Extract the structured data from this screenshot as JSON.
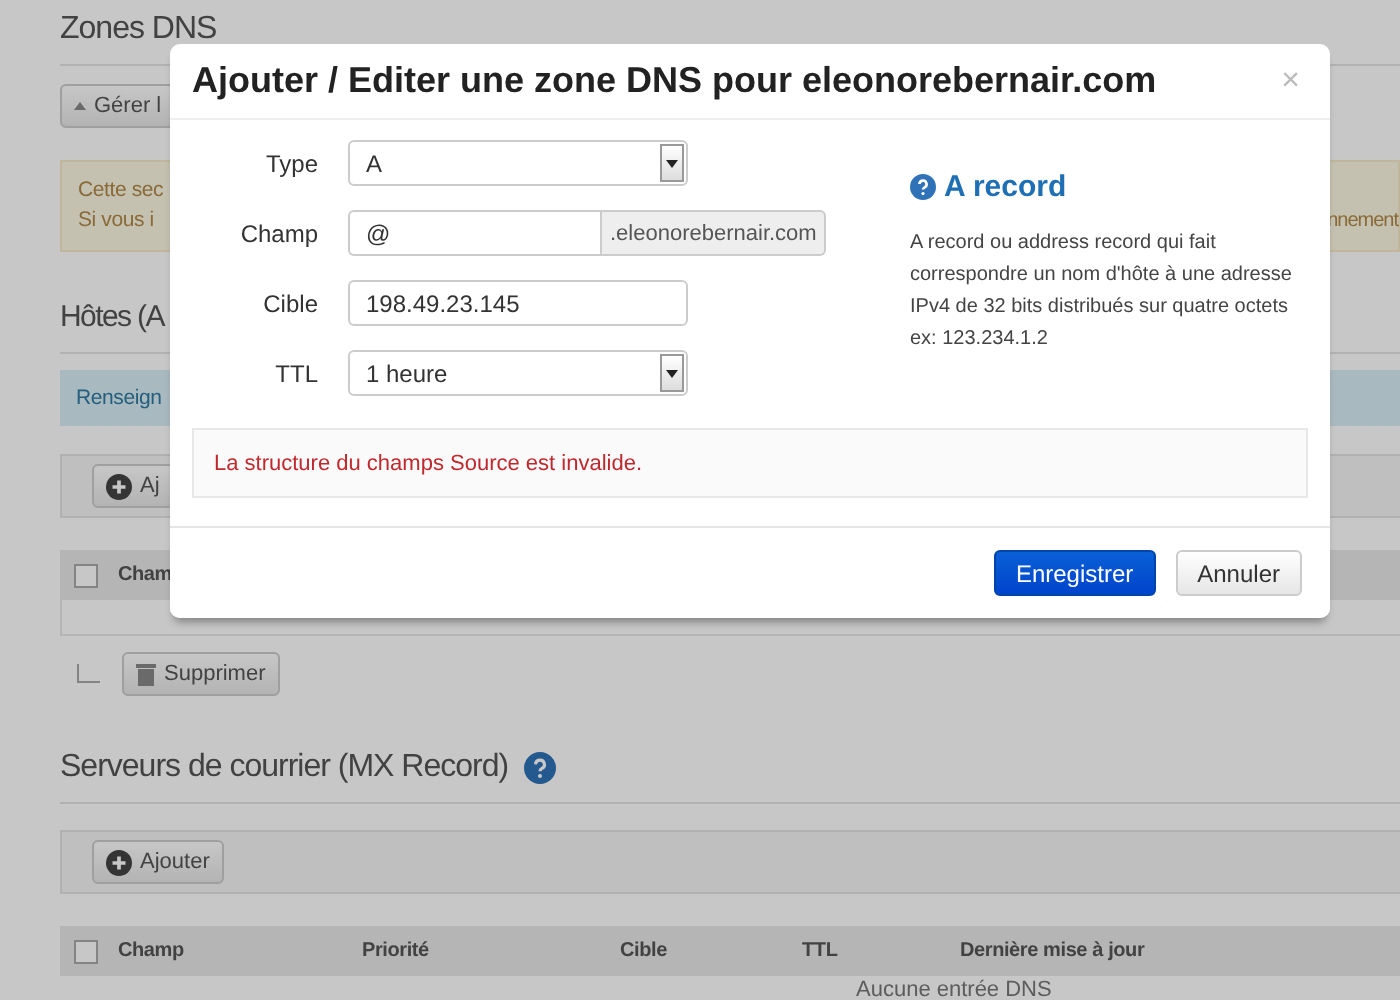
{
  "page": {
    "zones_title": "Zones DNS",
    "manage_button": "Gérer l",
    "notice_lines": [
      "Cette sec",
      "Si vous i"
    ],
    "notice_tail": "nnement",
    "hosts_title": "Hôtes (A",
    "hosts_info": "Renseign",
    "hosts_add": "Aj",
    "hosts_table": {
      "checked": false,
      "columns": [
        "Cham"
      ]
    },
    "delete_button": "Supprimer",
    "mx_title": "Serveurs de courrier (MX Record)",
    "mx_add": "Ajouter",
    "mx_table": {
      "checked": false,
      "columns": [
        "Champ",
        "Priorité",
        "Cible",
        "TTL",
        "Dernière mise à jour"
      ],
      "empty_text": "Aucune entrée DNS"
    }
  },
  "modal": {
    "title": "Ajouter / Editer une zone DNS pour eleonorebernair.com",
    "close": "×",
    "fields": [
      {
        "kind": "select",
        "label": "Type",
        "value": "A"
      },
      {
        "kind": "text",
        "label": "Champ",
        "value": "@",
        "suffix": ".eleonorebernair.com"
      },
      {
        "kind": "text",
        "label": "Cible",
        "value": "198.49.23.145"
      },
      {
        "kind": "select",
        "label": "TTL",
        "value": "1 heure"
      }
    ],
    "help": {
      "title": "A record",
      "lines": [
        "A record ou address record qui fait",
        "correspondre un nom d'hôte à une adresse",
        "IPv4 de 32 bits distribués sur quatre octets",
        "ex: 123.234.1.2"
      ]
    },
    "error": "La structure du champs Source est invalide.",
    "buttons": [
      {
        "label": "Enregistrer",
        "primary": true
      },
      {
        "label": "Annuler",
        "primary": false
      }
    ]
  }
}
